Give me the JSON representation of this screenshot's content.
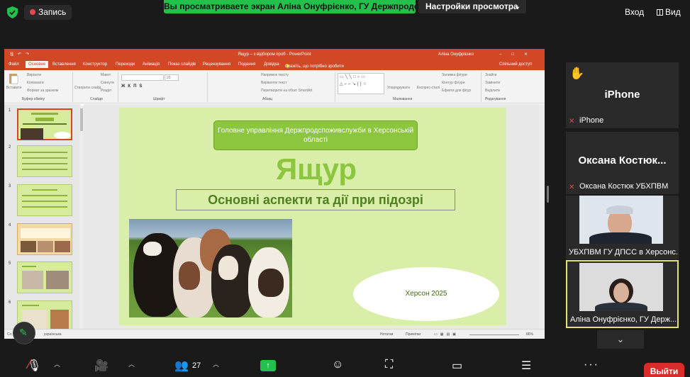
{
  "topbar": {
    "record_label": "Запись",
    "sharing_banner": "Вы просматриваете экран Аліна Онуфрієнко, ГУ Держпродс...",
    "view_options": "Настройки просмотра",
    "sign_in": "Вход",
    "view": "Вид"
  },
  "powerpoint": {
    "title": "Ящур – з відбором проб - PowerPoint",
    "user": "Аліна Онуфрієнко",
    "tabs": [
      "Файл",
      "Основне",
      "Вставлення",
      "Конструктор",
      "Переходи",
      "Анімація",
      "Показ слайдів",
      "Рецензування",
      "Подання",
      "Довідка",
      "Скажіть, що потрібно зробити",
      "Спільний доступ"
    ],
    "ribbon_groups": [
      "Буфер обміну",
      "Слайди",
      "Шрифт",
      "Абзац",
      "Малювання",
      "Редагування"
    ],
    "ribbon_items": {
      "paste": "Вставити",
      "cut": "Вирізати",
      "copy": "Копіювати",
      "format_painter": "Формат за зразком",
      "new_slide": "Створити слайд",
      "layout": "Макет",
      "reset": "Скинути",
      "section": "Розділ",
      "text_direction": "Напрямок тексту",
      "align_text": "Вирівняти текст",
      "smartart": "Перетворити на обєкт SmartArt",
      "arrange": "Упорядкувати",
      "quick_styles": "Експрес-стилі",
      "shape_fill": "Заливка фігури",
      "shape_outline": "Контур фігури",
      "shape_effects": "Ефекти для фігур",
      "find": "Знайти",
      "replace": "Замінити",
      "select": "Виділити"
    },
    "font_size": "20",
    "slide_numbers": [
      "1",
      "2",
      "3",
      "4",
      "5",
      "6"
    ],
    "status": {
      "slide": "Сл",
      "language": "українська",
      "notes": "Нотатки",
      "comments": "Примітки",
      "zoom": "86%"
    }
  },
  "slide": {
    "header": "Головне управління Держпродспоживслужби в Херсонській області",
    "title": "Ящур",
    "subtitle": "Основні аспекти та дії при підозрі",
    "footer": "Херсон 2025"
  },
  "participants": [
    {
      "big": "iPhone",
      "label": "iPhone"
    },
    {
      "big": "Оксана  Костюк...",
      "label": "Оксана Костюк  УБХПВМ"
    },
    {
      "label": "УБХПВМ ГУ ДПСС в Херсонс..."
    },
    {
      "label": "Аліна Онуфрієнко, ГУ Держ..."
    }
  ],
  "toolbar": {
    "participants_count": "27",
    "leave": "Выйти"
  },
  "colors": {
    "accent_green": "#23c14b",
    "ppt_orange": "#d24726",
    "slide_bg": "#d9eea8",
    "leave_red": "#d92c2c",
    "active_border": "#e1e36b"
  }
}
